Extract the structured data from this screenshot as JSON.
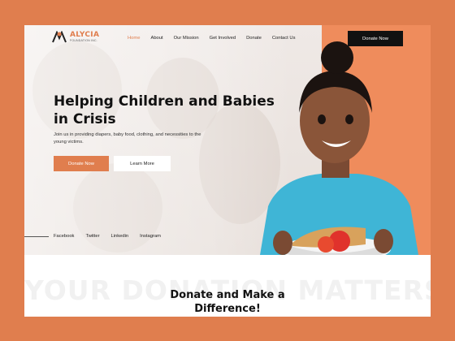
{
  "brand": {
    "name": "ALYCIA",
    "subtitle": "FOUNDATION INC.",
    "accent_color": "#E07E4E",
    "dark_color": "#111111"
  },
  "nav": {
    "items": [
      {
        "label": "Home",
        "active": true
      },
      {
        "label": "About",
        "active": false
      },
      {
        "label": "Our Mission",
        "active": false
      },
      {
        "label": "Get Involved",
        "active": false
      },
      {
        "label": "Donate",
        "active": false
      },
      {
        "label": "Contact Us",
        "active": false
      }
    ],
    "cta_label": "Donate Now"
  },
  "hero": {
    "headline": "Helping Children and Babies in Crisis",
    "subtext": "Join us in providing diapers, baby food, clothing, and necessities to the young victims.",
    "primary_button": "Donate Now",
    "secondary_button": "Learn More"
  },
  "social": {
    "links": [
      "Facebook",
      "Twitter",
      "Linkedin",
      "Instagram"
    ]
  },
  "section": {
    "watermark": "YOUR DONATION MATTERS",
    "title": "Donate and Make a Difference!"
  }
}
